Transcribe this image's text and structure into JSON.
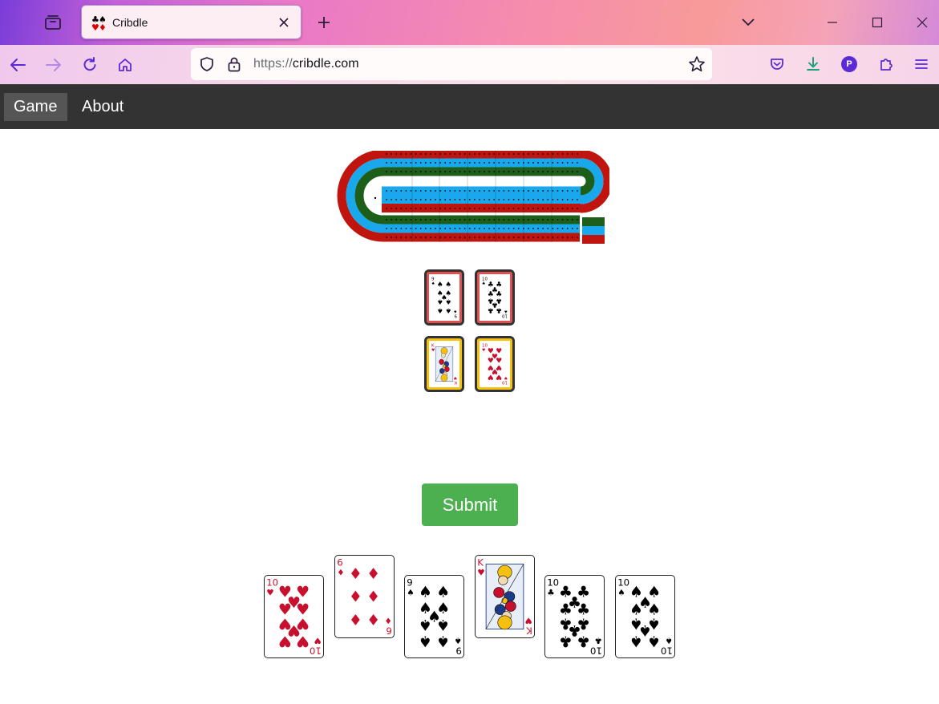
{
  "browser": {
    "tab": {
      "title": "Cribdle"
    },
    "url": {
      "scheme": "https://",
      "host": "cribdle.com"
    },
    "profile_initial": "P"
  },
  "site": {
    "nav": [
      {
        "label": "Game",
        "active": true
      },
      {
        "label": "About",
        "active": false
      }
    ],
    "submit_label": "Submit"
  },
  "crib": [
    {
      "rank": "9",
      "suit": "spades",
      "frame": "red"
    },
    {
      "rank": "10",
      "suit": "clubs",
      "frame": "red"
    },
    {
      "rank": "K",
      "suit": "hearts",
      "frame": "gold"
    },
    {
      "rank": "10",
      "suit": "hearts",
      "frame": "gold"
    }
  ],
  "hand": [
    {
      "rank": "10",
      "suit": "hearts",
      "raised": false
    },
    {
      "rank": "6",
      "suit": "diamonds",
      "raised": true
    },
    {
      "rank": "9",
      "suit": "spades",
      "raised": false
    },
    {
      "rank": "K",
      "suit": "hearts",
      "raised": true
    },
    {
      "rank": "10",
      "suit": "clubs",
      "raised": false
    },
    {
      "rank": "10",
      "suit": "spades",
      "raised": false
    }
  ],
  "colors": {
    "site_nav_bg": "#333333",
    "submit_bg": "#4caf50",
    "board_red": "#c0140f",
    "board_blue": "#1aa8ec",
    "board_green": "#1d5e1a"
  }
}
